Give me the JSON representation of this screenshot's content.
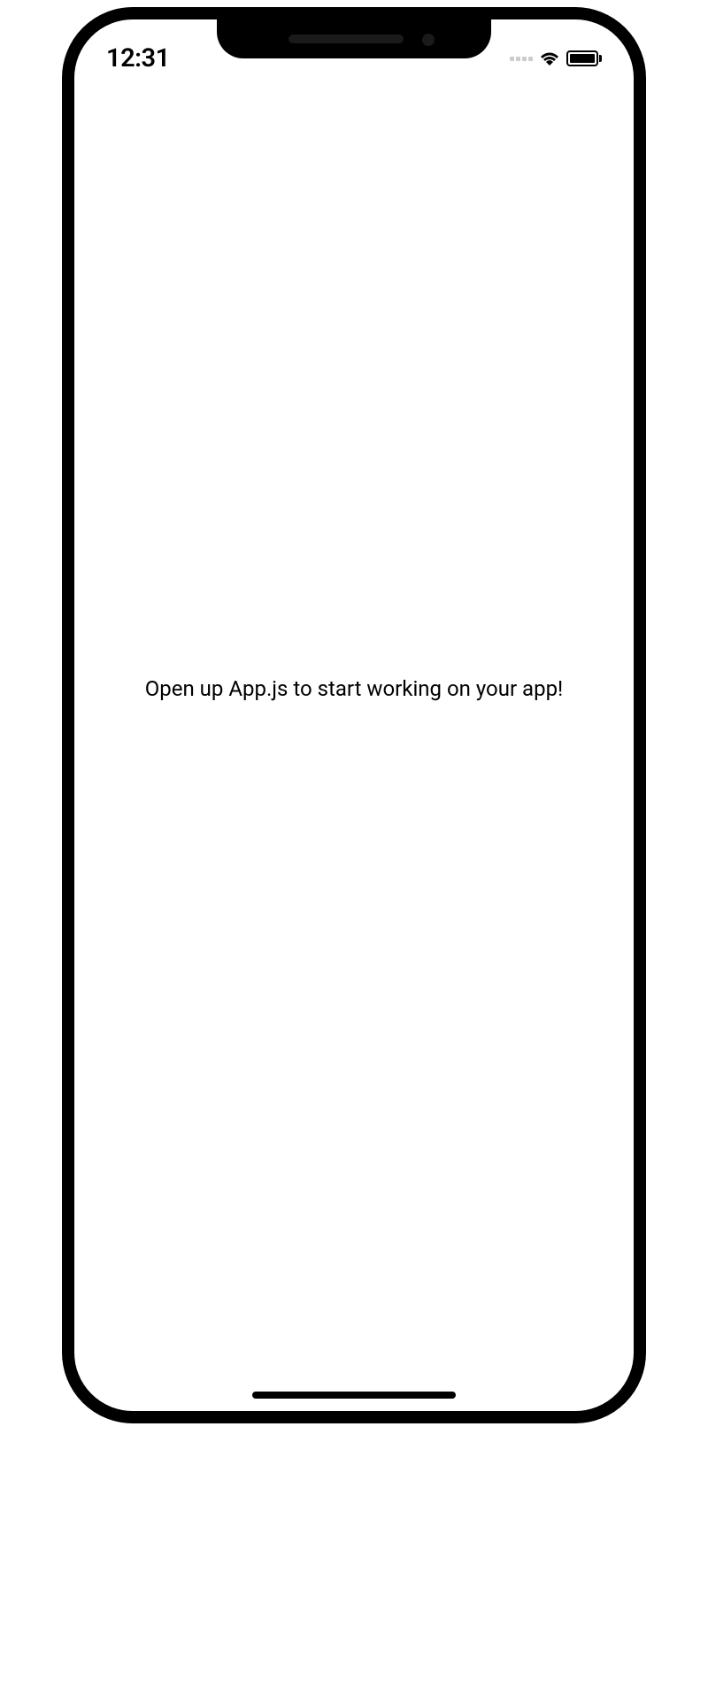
{
  "status_bar": {
    "time": "12:31"
  },
  "content": {
    "welcome_text": "Open up App.js to start working on your app!"
  }
}
